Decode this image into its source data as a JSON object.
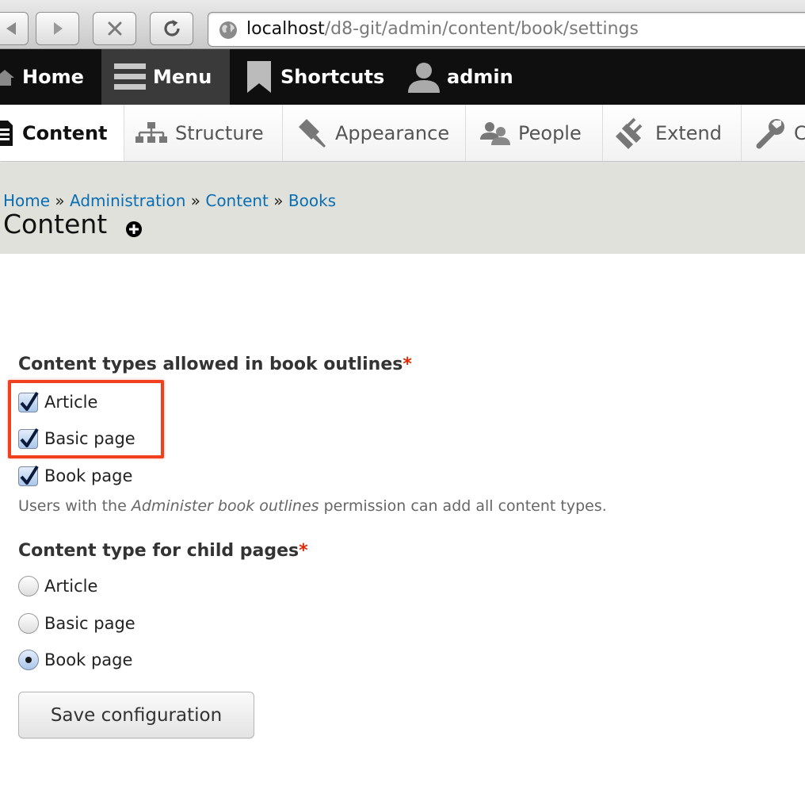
{
  "browser": {
    "url_host": "localhost",
    "url_path": "/d8-git/admin/content/book/settings"
  },
  "toolbar": {
    "home_label": "Home",
    "menu_label": "Menu",
    "shortcuts_label": "Shortcuts",
    "user_label": "admin"
  },
  "tray": {
    "content_label": "Content",
    "structure_label": "Structure",
    "appearance_label": "Appearance",
    "people_label": "People",
    "extend_label": "Extend",
    "config_label": "C"
  },
  "breadcrumb": {
    "items": [
      "Home",
      "Administration",
      "Content",
      "Books"
    ],
    "separator": "»"
  },
  "page": {
    "title": "Content"
  },
  "form": {
    "allowed_types": {
      "label": "Content types allowed in book outlines",
      "required_mark": "*",
      "options": [
        {
          "label": "Article",
          "checked": true
        },
        {
          "label": "Basic page",
          "checked": true
        },
        {
          "label": "Book page",
          "checked": true
        }
      ],
      "description_before": "Users with the ",
      "description_em": "Administer book outlines",
      "description_after": " permission can add all content types."
    },
    "child_type": {
      "label": "Content type for child pages",
      "required_mark": "*",
      "options": [
        {
          "label": "Article",
          "selected": false
        },
        {
          "label": "Basic page",
          "selected": false
        },
        {
          "label": "Book page",
          "selected": true
        }
      ]
    },
    "submit_label": "Save configuration"
  },
  "colors": {
    "link": "#0a6eb4",
    "required": "#e32700",
    "highlight": "#f1401e",
    "toolbar_bg": "#0f0f0f",
    "header_bg": "#e1e1db"
  }
}
